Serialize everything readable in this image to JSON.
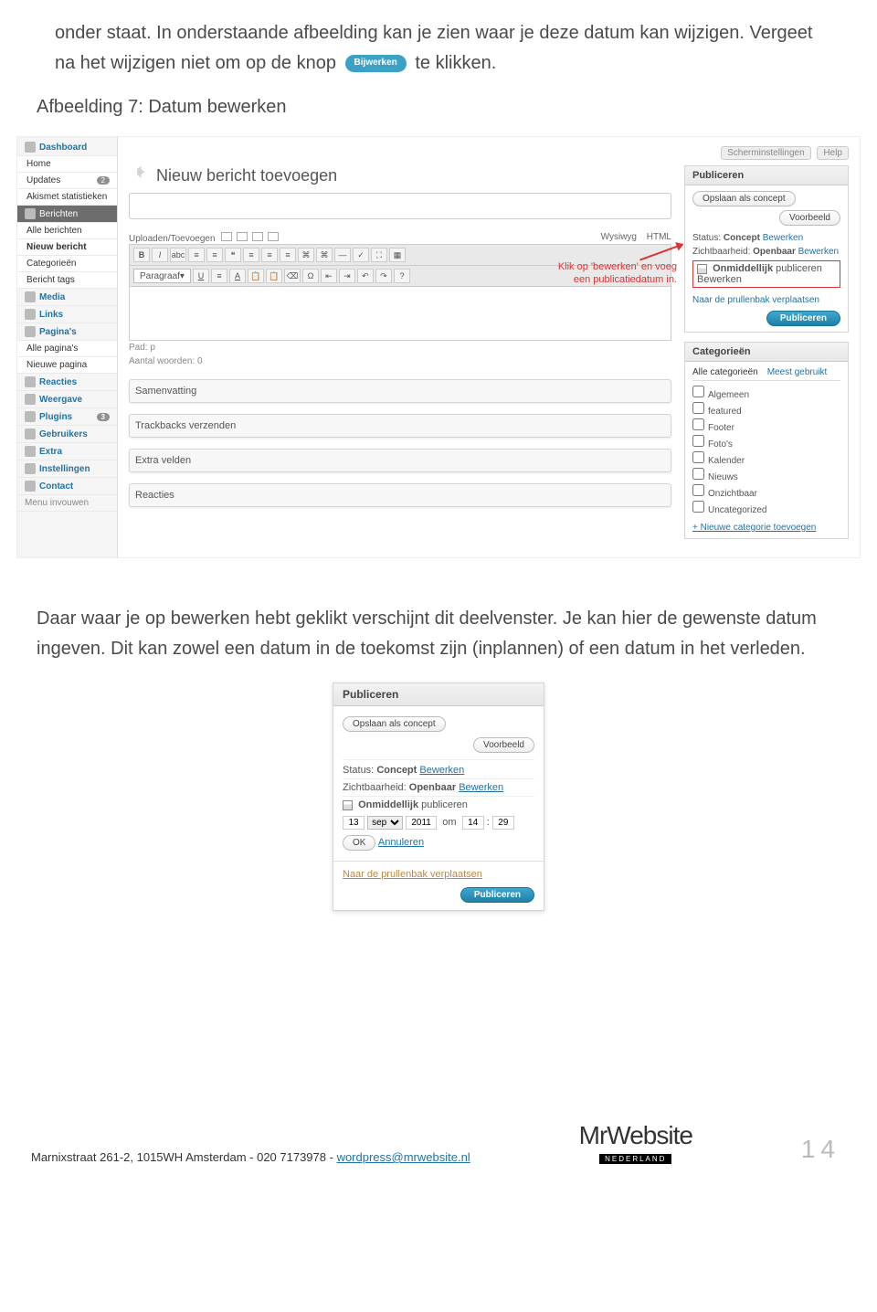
{
  "doc": {
    "p1a": "onder staat. In onderstaande afbeelding kan je zien waar je deze datum kan wijzigen. Vergeet na het wijzigen niet om op de knop",
    "p1_btn": "Bijwerken",
    "p1b": "te klikken.",
    "caption1": "Afbeelding 7: Datum bewerken",
    "p2": "Daar waar je op bewerken hebt geklikt verschijnt dit deelvenster. Je kan hier de gewenste datum ingeven. Dit kan zowel een datum in de toekomst zijn (inplannen) of een datum in het verleden."
  },
  "wp": {
    "screen_options": "Scherminstellingen",
    "help": "Help",
    "title_heading": "Nieuw bericht toevoegen",
    "upload_label": "Uploaden/Toevoegen",
    "tab_wysiwyg": "Wysiwyg",
    "tab_html": "HTML",
    "para_select": "Paragraaf",
    "editor_path": "Pad: p",
    "word_count_label": "Aantal woorden: 0",
    "annotation_l1": "Klik op 'bewerken' en voeg",
    "annotation_l2": "een publicatiedatum in.",
    "meta_boxes": [
      "Samenvatting",
      "Trackbacks verzenden",
      "Extra velden",
      "Reacties"
    ],
    "sidebar": [
      {
        "label": "Dashboard",
        "type": "section",
        "icon": "home-icon"
      },
      {
        "label": "Home",
        "type": "sub"
      },
      {
        "label": "Updates",
        "type": "sub",
        "badge": "2"
      },
      {
        "label": "Akismet statistieken",
        "type": "sub"
      },
      {
        "label": "Berichten",
        "type": "active",
        "icon": "pin-icon"
      },
      {
        "label": "Alle berichten",
        "type": "sub"
      },
      {
        "label": "Nieuw bericht",
        "type": "sub",
        "bold": true
      },
      {
        "label": "Categorieën",
        "type": "sub"
      },
      {
        "label": "Bericht tags",
        "type": "sub"
      },
      {
        "label": "Media",
        "type": "section",
        "icon": "media-icon"
      },
      {
        "label": "Links",
        "type": "section",
        "icon": "links-icon"
      },
      {
        "label": "Pagina's",
        "type": "section",
        "icon": "pages-icon"
      },
      {
        "label": "Alle pagina's",
        "type": "sub"
      },
      {
        "label": "Nieuwe pagina",
        "type": "sub"
      },
      {
        "label": "Reacties",
        "type": "section",
        "icon": "comments-icon"
      },
      {
        "label": "Weergave",
        "type": "section",
        "icon": "appearance-icon"
      },
      {
        "label": "Plugins",
        "type": "section",
        "icon": "plugins-icon",
        "badge": "3"
      },
      {
        "label": "Gebruikers",
        "type": "section",
        "icon": "users-icon"
      },
      {
        "label": "Extra",
        "type": "section",
        "icon": "tools-icon"
      },
      {
        "label": "Instellingen",
        "type": "section",
        "icon": "settings-icon"
      },
      {
        "label": "Contact",
        "type": "section",
        "icon": "contact-icon"
      },
      {
        "label": "Menu invouwen",
        "type": "collapse"
      }
    ],
    "publish": {
      "title": "Publiceren",
      "save_draft": "Opslaan als concept",
      "preview": "Voorbeeld",
      "status_label": "Status:",
      "status_value": "Concept",
      "edit_status": "Bewerken",
      "visibility_label": "Zichtbaarheid:",
      "visibility_value": "Openbaar",
      "edit_visibility": "Bewerken",
      "schedule_prefix": "Onmiddellijk",
      "schedule_suffix": "publiceren",
      "edit_schedule": "Bewerken",
      "trash": "Naar de prullenbak verplaatsen",
      "publish_btn": "Publiceren"
    },
    "categories": {
      "title": "Categorieën",
      "tab_all": "Alle categorieën",
      "tab_most": "Meest gebruikt",
      "items": [
        "Algemeen",
        "featured",
        "Footer",
        "Foto's",
        "Kalender",
        "Nieuws",
        "Onzichtbaar",
        "Uncategorized"
      ],
      "add_link": "+ Nieuwe categorie toevoegen"
    }
  },
  "pub2": {
    "title": "Publiceren",
    "save_draft": "Opslaan als concept",
    "preview": "Voorbeeld",
    "status_label": "Status:",
    "status_value": "Concept",
    "edit_status": "Bewerken",
    "visibility_label": "Zichtbaarheid:",
    "visibility_value": "Openbaar",
    "edit_visibility": "Bewerken",
    "schedule_prefix": "Onmiddellijk",
    "schedule_suffix": "publiceren",
    "day": "13",
    "month": "sep",
    "year": "2011",
    "at": "om",
    "hour": "14",
    "minute": "29",
    "ok": "OK",
    "cancel": "Annuleren",
    "trash": "Naar de prullenbak verplaatsen",
    "publish_btn": "Publiceren"
  },
  "footer": {
    "addr_a": "Marnixstraat 261-2, 1015WH Amsterdam - 020 7173978 - ",
    "addr_link": "wordpress@mrwebsite.nl",
    "logo_a": "Mr",
    "logo_b": "Website",
    "ned": "NEDERLAND",
    "page": "14"
  }
}
